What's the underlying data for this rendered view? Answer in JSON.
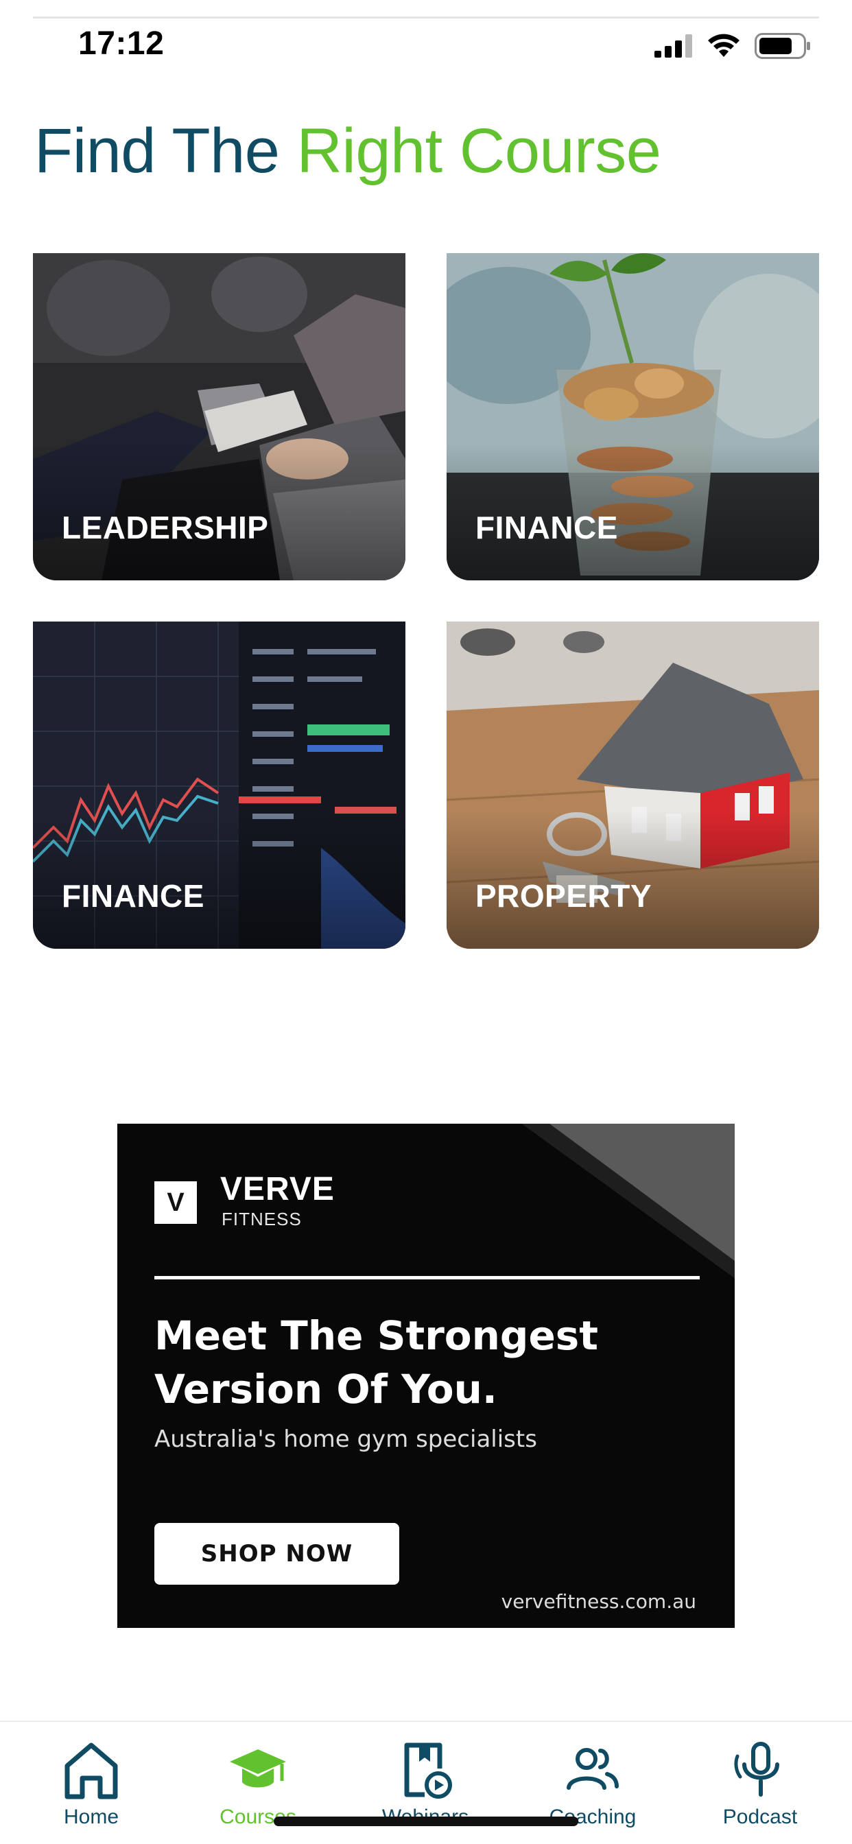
{
  "status_bar": {
    "time": "17:12",
    "battery_level": 0.75
  },
  "heading": {
    "part1": "Find The",
    "part2": "Right Course"
  },
  "colors": {
    "primary": "#0f4c63",
    "accent": "#62c12e"
  },
  "courses": [
    {
      "label": "LEADERSHIP",
      "image": "people-taking-notes"
    },
    {
      "label": "FINANCE",
      "image": "coins-in-jar-with-plant"
    },
    {
      "label": "FINANCE",
      "image": "stock-market-chart"
    },
    {
      "label": "PROPERTY",
      "image": "model-house-with-keys"
    }
  ],
  "ad": {
    "logo_letter": "V",
    "brand": "VERVE",
    "brand_sub": "FITNESS",
    "headline_line1": "Meet The Strongest",
    "headline_line2": "Version Of You.",
    "subtext": "Australia's home gym specialists",
    "cta": "SHOP NOW",
    "url": "vervefitness.com.au"
  },
  "tabbar": {
    "items": [
      {
        "label": "Home",
        "icon": "home-icon",
        "active": false
      },
      {
        "label": "Courses",
        "icon": "graduation-cap-icon",
        "active": true
      },
      {
        "label": "Webinars",
        "icon": "webinar-play-icon",
        "active": false
      },
      {
        "label": "Coaching",
        "icon": "people-icon",
        "active": false
      },
      {
        "label": "Podcast",
        "icon": "microphone-icon",
        "active": false
      }
    ]
  }
}
